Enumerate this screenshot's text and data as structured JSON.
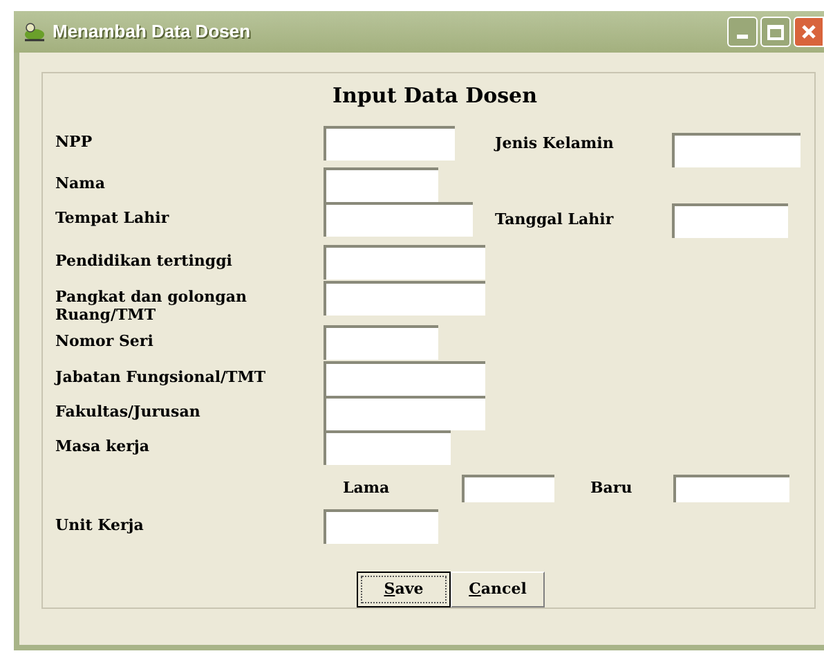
{
  "window": {
    "title": "Menambah Data Dosen"
  },
  "form_title": "Input Data Dosen",
  "fields": [
    {
      "label": "NPP"
    },
    {
      "label": "Nama"
    },
    {
      "label": "Tempat Lahir"
    },
    {
      "label": "Pendidikan tertinggi"
    },
    {
      "label": "Pangkat dan golongan Ruang/TMT"
    },
    {
      "label": "Nomor Seri"
    },
    {
      "label": "Jabatan Fungsional/TMT"
    },
    {
      "label": "Fakultas/Jurusan"
    },
    {
      "label": "Masa kerja"
    },
    {
      "label": "Unit Kerja"
    }
  ],
  "side_fields": [
    {
      "label": "Jenis Kelamin"
    },
    {
      "label": "Tanggal Lahir"
    }
  ],
  "masa_kerja_parts": [
    {
      "label": "Lama"
    },
    {
      "label": "Baru"
    }
  ],
  "buttons": [
    {
      "label": "Save",
      "default": true
    },
    {
      "label": "Cancel",
      "default": false
    }
  ]
}
